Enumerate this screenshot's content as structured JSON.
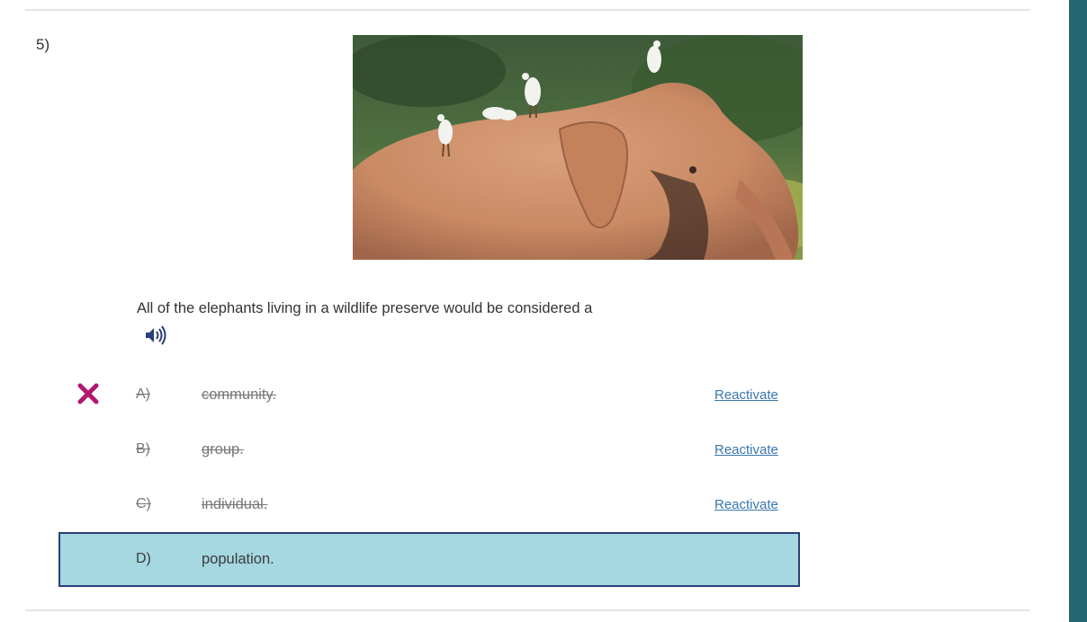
{
  "question": {
    "number": "5)",
    "stem": "All of the elephants living in a wildlife preserve would be considered a",
    "image_icon": "elephant-with-egrets-photo",
    "audio_icon": "speaker-icon"
  },
  "options": [
    {
      "letter": "A)",
      "text": "community.",
      "state": "eliminated",
      "action": "Reactivate",
      "mark": "x-icon"
    },
    {
      "letter": "B)",
      "text": "group.",
      "state": "eliminated",
      "action": "Reactivate"
    },
    {
      "letter": "C)",
      "text": "individual.",
      "state": "eliminated",
      "action": "Reactivate"
    },
    {
      "letter": "D)",
      "text": "population.",
      "state": "selected"
    }
  ],
  "colors": {
    "accent_sidebar": "#256673",
    "selected_bg": "#a5d8e1",
    "selected_border": "#2b3e7a",
    "x_mark": "#b0196f",
    "link": "#3a77b0"
  }
}
